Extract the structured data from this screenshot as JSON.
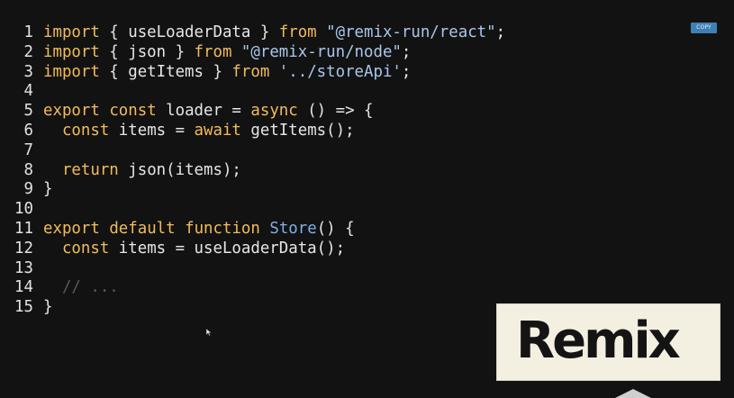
{
  "toolbar": {
    "copy_label": "COPY"
  },
  "code": {
    "lines": [
      {
        "num": "1",
        "tokens": [
          {
            "t": "kw",
            "v": "import"
          },
          {
            "t": "txt",
            "v": " { useLoaderData } "
          },
          {
            "t": "kw",
            "v": "from"
          },
          {
            "t": "txt",
            "v": " "
          },
          {
            "t": "str",
            "v": "\"@remix-run/react\""
          },
          {
            "t": "txt",
            "v": ";"
          }
        ]
      },
      {
        "num": "2",
        "tokens": [
          {
            "t": "kw",
            "v": "import"
          },
          {
            "t": "txt",
            "v": " { json } "
          },
          {
            "t": "kw",
            "v": "from"
          },
          {
            "t": "txt",
            "v": " "
          },
          {
            "t": "str",
            "v": "\"@remix-run/node\""
          },
          {
            "t": "txt",
            "v": ";"
          }
        ]
      },
      {
        "num": "3",
        "tokens": [
          {
            "t": "kw",
            "v": "import"
          },
          {
            "t": "txt",
            "v": " { getItems } "
          },
          {
            "t": "kw",
            "v": "from"
          },
          {
            "t": "txt",
            "v": " "
          },
          {
            "t": "str",
            "v": "'../storeApi'"
          },
          {
            "t": "txt",
            "v": ";"
          }
        ]
      },
      {
        "num": "4",
        "tokens": []
      },
      {
        "num": "5",
        "tokens": [
          {
            "t": "kw",
            "v": "export"
          },
          {
            "t": "txt",
            "v": " "
          },
          {
            "t": "kw",
            "v": "const"
          },
          {
            "t": "txt",
            "v": " loader = "
          },
          {
            "t": "kw",
            "v": "async"
          },
          {
            "t": "txt",
            "v": " () => {"
          }
        ]
      },
      {
        "num": "6",
        "tokens": [
          {
            "t": "txt",
            "v": "  "
          },
          {
            "t": "kw",
            "v": "const"
          },
          {
            "t": "txt",
            "v": " items = "
          },
          {
            "t": "kw",
            "v": "await"
          },
          {
            "t": "txt",
            "v": " getItems();"
          }
        ]
      },
      {
        "num": "7",
        "tokens": []
      },
      {
        "num": "8",
        "tokens": [
          {
            "t": "txt",
            "v": "  "
          },
          {
            "t": "kw",
            "v": "return"
          },
          {
            "t": "txt",
            "v": " json(items);"
          }
        ]
      },
      {
        "num": "9",
        "tokens": [
          {
            "t": "txt",
            "v": "}"
          }
        ]
      },
      {
        "num": "10",
        "tokens": []
      },
      {
        "num": "11",
        "tokens": [
          {
            "t": "kw",
            "v": "export"
          },
          {
            "t": "txt",
            "v": " "
          },
          {
            "t": "kw",
            "v": "default"
          },
          {
            "t": "txt",
            "v": " "
          },
          {
            "t": "kw",
            "v": "function"
          },
          {
            "t": "txt",
            "v": " "
          },
          {
            "t": "cls",
            "v": "Store"
          },
          {
            "t": "txt",
            "v": "() {"
          }
        ]
      },
      {
        "num": "12",
        "tokens": [
          {
            "t": "txt",
            "v": "  "
          },
          {
            "t": "kw",
            "v": "const"
          },
          {
            "t": "txt",
            "v": " items = useLoaderData();"
          }
        ]
      },
      {
        "num": "13",
        "tokens": []
      },
      {
        "num": "14",
        "tokens": [
          {
            "t": "txt",
            "v": "  "
          },
          {
            "t": "cmt",
            "v": "// ..."
          }
        ]
      },
      {
        "num": "15",
        "tokens": [
          {
            "t": "txt",
            "v": "}"
          }
        ]
      }
    ]
  },
  "logo": {
    "text": "Remix"
  },
  "colors": {
    "background": "#121212",
    "keyword": "#f2bc5a",
    "string": "#a9c7ec",
    "class_name": "#7fb0e8",
    "comment": "#5a5a5a",
    "copy_button": "#3f7fb5",
    "logo_background": "#f4f0e1"
  },
  "icons": {
    "cursor": "mouse-cursor-icon"
  }
}
